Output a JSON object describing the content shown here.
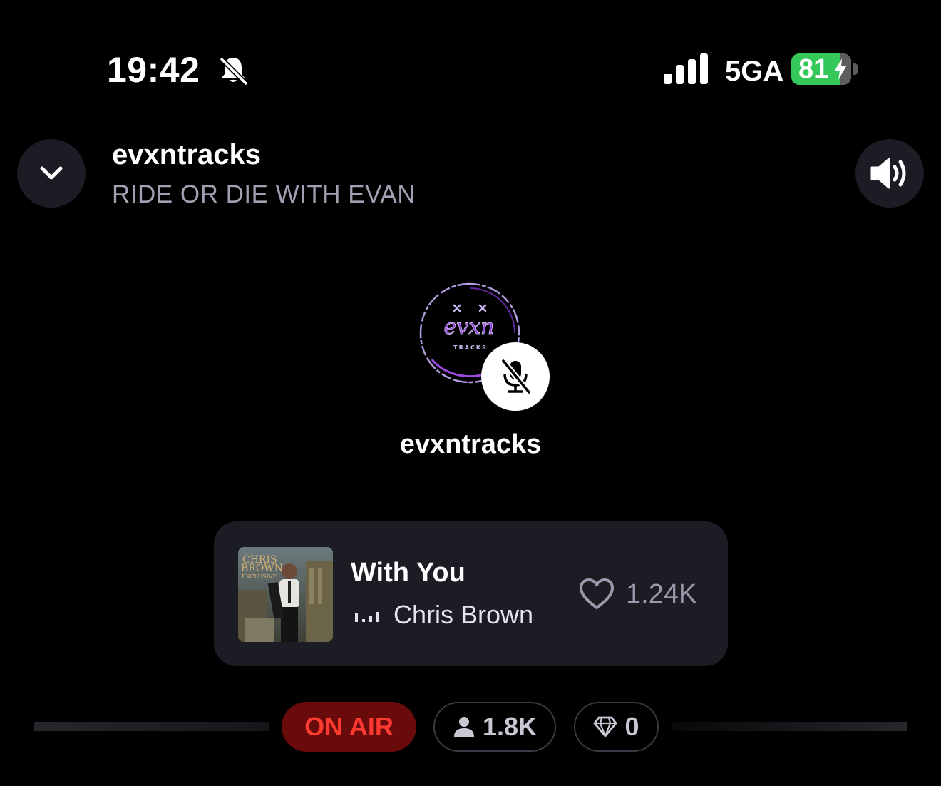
{
  "status_bar": {
    "time": "19:42",
    "network": "5GA",
    "battery": "81"
  },
  "header": {
    "title": "evxntracks",
    "subtitle": "RIDE OR DIE WITH EVAN"
  },
  "host": {
    "name": "evxntracks",
    "logo_text": "evxn",
    "logo_subtext": "TRACKS",
    "mic_state": "muted"
  },
  "now_playing": {
    "song": "With You",
    "artist": "Chris Brown",
    "likes": "1.24K",
    "album_art_text": [
      "CHRIS",
      "BROWN",
      "EXCLUSIVE"
    ]
  },
  "stats": {
    "live_label": "ON AIR",
    "listeners": "1.8K",
    "gems": "0"
  },
  "colors": {
    "background": "#000000",
    "card": "#1c1c24",
    "on_air_bg": "#6a0b0b",
    "on_air_text": "#ff3a30",
    "battery": "#34c759",
    "logo_accent": "#8a3ad8"
  },
  "icons": {
    "collapse": "chevron-down-icon",
    "volume": "speaker-icon",
    "silent": "bell-slash-icon",
    "mic": "mic-off-icon",
    "like": "heart-icon",
    "listeners": "person-icon",
    "gems": "diamond-icon"
  }
}
